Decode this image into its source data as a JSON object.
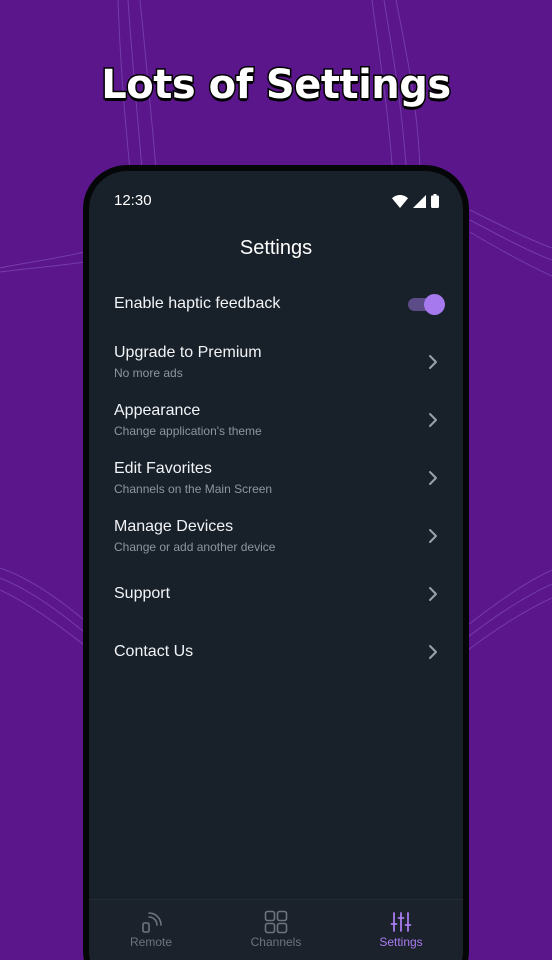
{
  "headline": "Lots of Settings",
  "status_bar": {
    "time": "12:30",
    "icons": [
      "wifi-icon",
      "signal-icon",
      "battery-icon"
    ]
  },
  "screen_title": "Settings",
  "settings": {
    "haptic": {
      "label": "Enable haptic feedback",
      "enabled": true
    },
    "items": [
      {
        "label": "Upgrade to Premium",
        "subtitle": "No more ads"
      },
      {
        "label": "Appearance",
        "subtitle": "Change application's theme"
      },
      {
        "label": "Edit Favorites",
        "subtitle": "Channels on the Main Screen"
      },
      {
        "label": "Manage Devices",
        "subtitle": "Change or add another device"
      },
      {
        "label": "Support",
        "subtitle": ""
      },
      {
        "label": "Contact Us",
        "subtitle": ""
      }
    ]
  },
  "bottom_nav": {
    "items": [
      {
        "label": "Remote",
        "icon": "remote-cast-icon",
        "active": false
      },
      {
        "label": "Channels",
        "icon": "grid-icon",
        "active": false
      },
      {
        "label": "Settings",
        "icon": "sliders-icon",
        "active": true
      }
    ]
  },
  "colors": {
    "background": "#5a168a",
    "screen": "#182029",
    "accent": "#a97bf0",
    "toggle_track": "#5b4b86"
  }
}
